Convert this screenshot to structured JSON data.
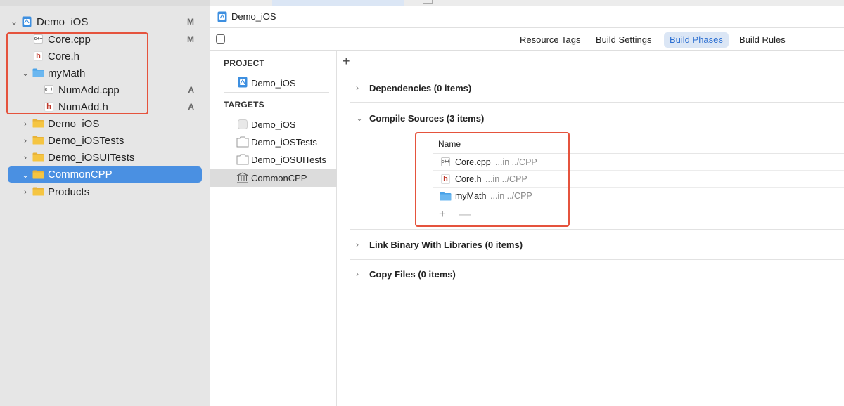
{
  "navigator": {
    "items": [
      {
        "label": "Demo_iOS",
        "badge": "M"
      },
      {
        "label": "Core.cpp",
        "badge": "M"
      },
      {
        "label": "Core.h",
        "badge": ""
      },
      {
        "label": "myMath",
        "badge": ""
      },
      {
        "label": "NumAdd.cpp",
        "badge": "A"
      },
      {
        "label": "NumAdd.h",
        "badge": "A"
      },
      {
        "label": "Demo_iOS",
        "badge": ""
      },
      {
        "label": "Demo_iOSTests",
        "badge": ""
      },
      {
        "label": "Demo_iOSUITests",
        "badge": ""
      },
      {
        "label": "CommonCPP",
        "badge": ""
      },
      {
        "label": "Products",
        "badge": ""
      }
    ]
  },
  "editor": {
    "jumpbar": {
      "title": "Demo_iOS"
    },
    "tabs": [
      {
        "label": "Resource Tags"
      },
      {
        "label": "Build Settings"
      },
      {
        "label": "Build Phases"
      },
      {
        "label": "Build Rules"
      }
    ],
    "project_header": "PROJECT",
    "project_item": "Demo_iOS",
    "targets_header": "TARGETS",
    "targets": [
      {
        "label": "Demo_iOS"
      },
      {
        "label": "Demo_iOSTests"
      },
      {
        "label": "Demo_iOSUITests"
      },
      {
        "label": "CommonCPP"
      }
    ],
    "add_phase": "+",
    "phases": [
      {
        "title": "Dependencies (0 items)"
      },
      {
        "title": "Compile Sources (3 items)"
      },
      {
        "title": "Link Binary With Libraries (0 items)"
      },
      {
        "title": "Copy Files (0 items)"
      }
    ],
    "compile_sources": {
      "column_name": "Name",
      "rows": [
        {
          "name": "Core.cpp",
          "location": "...in ../CPP",
          "icon": "cpp-file-icon"
        },
        {
          "name": "Core.h",
          "location": "...in ../CPP",
          "icon": "h-file-icon"
        },
        {
          "name": "myMath",
          "location": "...in ../CPP",
          "icon": "folder-icon"
        }
      ],
      "add": "+",
      "remove": "—"
    }
  },
  "colors": {
    "selection": "#4a90e2",
    "active_tab": "#2c6fd1",
    "annotation": "#e5533d",
    "folder": "#f5c542",
    "blue_folder": "#4aa3e8"
  }
}
